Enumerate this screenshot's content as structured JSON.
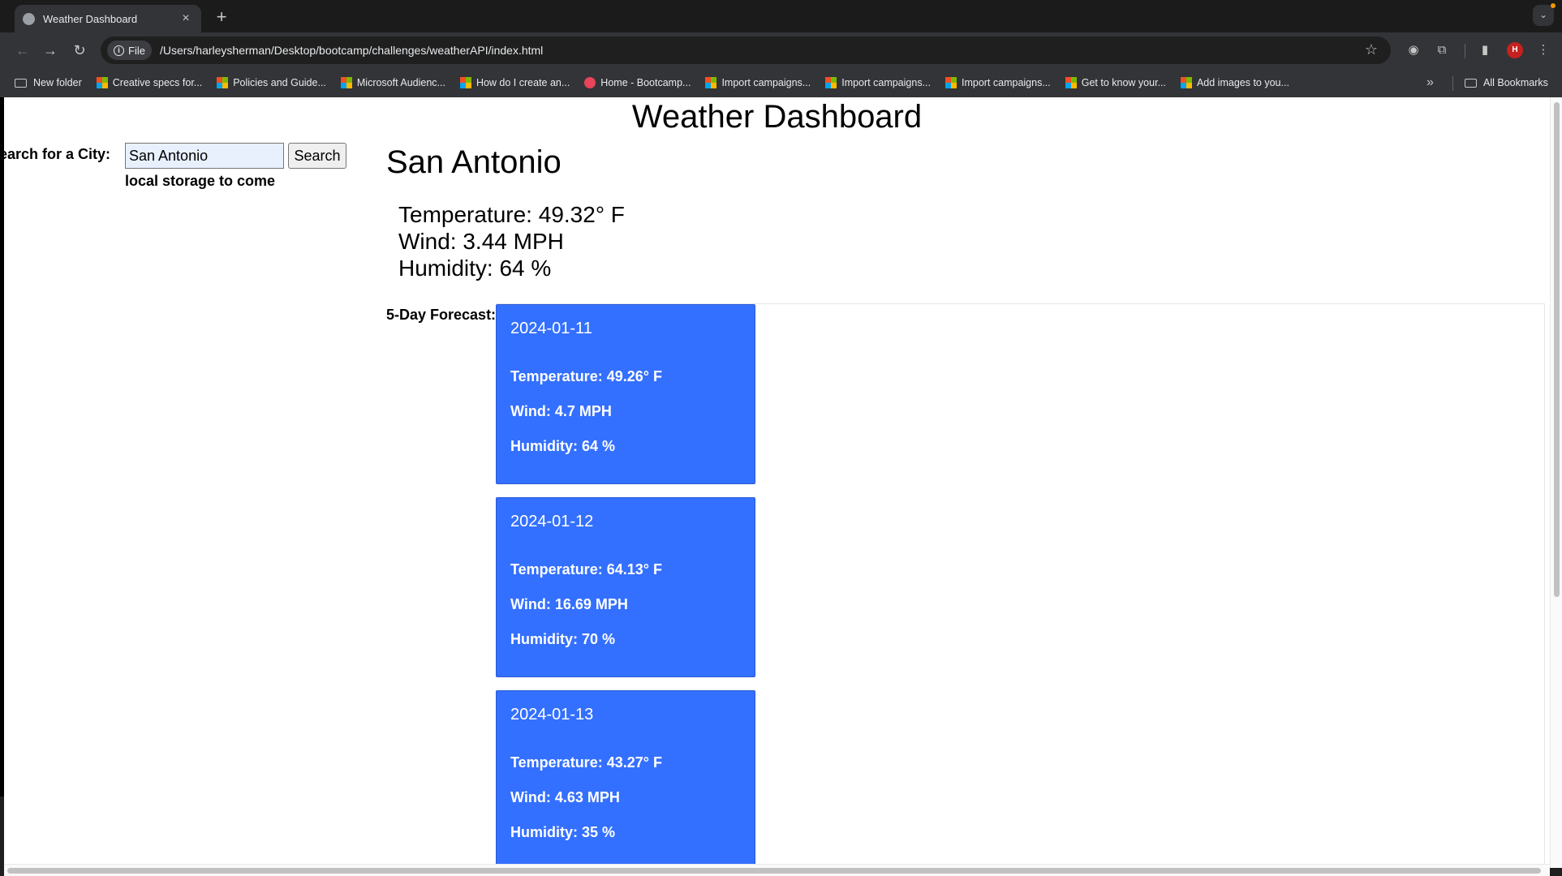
{
  "browser": {
    "tab_title": "Weather Dashboard",
    "tab_close": "×",
    "new_tab": "+",
    "url_chip": "File",
    "url": "/Users/harleysherman/Desktop/bootcamp/challenges/weatherAPI/index.html",
    "avatar_initial": "H",
    "bookmarks": [
      {
        "label": "New folder",
        "icon": "folder-icon"
      },
      {
        "label": "Creative specs for...",
        "icon": "microsoft-icon"
      },
      {
        "label": "Policies and Guide...",
        "icon": "microsoft-icon"
      },
      {
        "label": "Microsoft Audienc...",
        "icon": "microsoft-icon"
      },
      {
        "label": "How do I create an...",
        "icon": "microsoft-icon"
      },
      {
        "label": "Home - Bootcamp...",
        "icon": "bootcamp-icon"
      },
      {
        "label": "Import campaigns...",
        "icon": "microsoft-icon"
      },
      {
        "label": "Import campaigns...",
        "icon": "microsoft-icon"
      },
      {
        "label": "Import campaigns...",
        "icon": "microsoft-icon"
      },
      {
        "label": "Get to know your...",
        "icon": "microsoft-icon"
      },
      {
        "label": "Add images to you...",
        "icon": "microsoft-icon"
      }
    ],
    "bookmarks_more": "»",
    "all_bookmarks": "All Bookmarks"
  },
  "page": {
    "title": "Weather Dashboard",
    "search_label": "earch for a City:",
    "search_value": "San Antonio",
    "search_button": "Search",
    "storage_note": "local storage to come",
    "city": "San Antonio",
    "current": {
      "temperature": "Temperature: 49.32° F",
      "wind": "Wind: 3.44 MPH",
      "humidity": "Humidity: 64 %"
    },
    "forecast_label": "5-Day Forecast:",
    "forecast": [
      {
        "date": "2024-01-11",
        "temperature": "Temperature: 49.26° F",
        "wind": "Wind: 4.7 MPH",
        "humidity": "Humidity: 64 %"
      },
      {
        "date": "2024-01-12",
        "temperature": "Temperature: 64.13° F",
        "wind": "Wind: 16.69 MPH",
        "humidity": "Humidity: 70 %"
      },
      {
        "date": "2024-01-13",
        "temperature": "Temperature: 43.27° F",
        "wind": "Wind: 4.63 MPH",
        "humidity": "Humidity: 35 %"
      }
    ]
  },
  "colors": {
    "card_blue": "#3470ff",
    "chrome_dark": "#202124"
  }
}
